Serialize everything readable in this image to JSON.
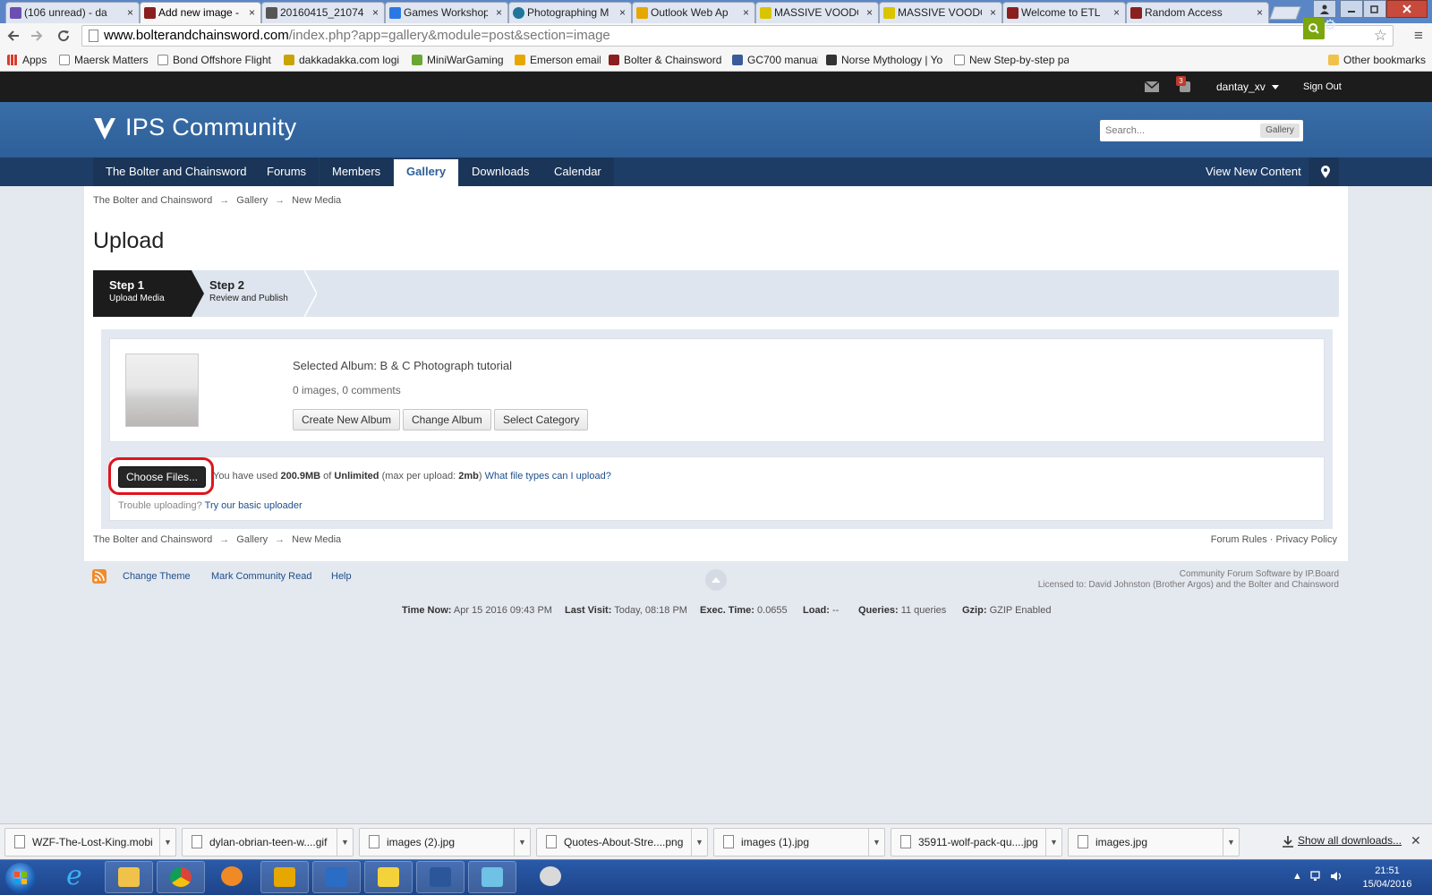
{
  "browser": {
    "tabs": [
      {
        "title": "(106 unread) - da",
        "favicon_color": "#6b4fb0"
      },
      {
        "title": "Add new image -",
        "favicon_color": "#8a1f1f"
      },
      {
        "title": "20160415_21074",
        "favicon_color": "#555555"
      },
      {
        "title": "Games Workshop",
        "favicon_color": "#2b78e4"
      },
      {
        "title": "Photographing M",
        "favicon_color": "#21759b"
      },
      {
        "title": "Outlook Web Ap",
        "favicon_color": "#e6a700"
      },
      {
        "title": "MASSIVE VOODO",
        "favicon_color": "#d9c400"
      },
      {
        "title": "MASSIVE VOODO",
        "favicon_color": "#d9c400"
      },
      {
        "title": "Welcome to ETL",
        "favicon_color": "#8a1f1f"
      },
      {
        "title": "Random Access",
        "favicon_color": "#8a1f1f"
      }
    ],
    "tab_close_glyph": "×",
    "url_host": "www.bolterandchainsword.com",
    "url_path": "/index.php?app=gallery&module=post&section=image",
    "bookmarks": [
      {
        "label": "Apps",
        "icon_color": "#d93b2b"
      },
      {
        "label": "Maersk Matters",
        "icon_color": "#cccccc"
      },
      {
        "label": "Bond Offshore Flight",
        "icon_color": "#cccccc"
      },
      {
        "label": "dakkadakka.com logi",
        "icon_color": "#c9a400"
      },
      {
        "label": "MiniWarGaming",
        "icon_color": "#6aa632"
      },
      {
        "label": "Emerson email",
        "icon_color": "#e6a700"
      },
      {
        "label": "Bolter & Chainsword",
        "icon_color": "#8a1f1f"
      },
      {
        "label": "GC700 manual",
        "icon_color": "#3b5a9a"
      },
      {
        "label": "Norse Mythology | Yo",
        "icon_color": "#333333"
      },
      {
        "label": "New Step-by-step pa",
        "icon_color": "#cccccc"
      }
    ],
    "other_bookmarks": "Other bookmarks"
  },
  "userbar": {
    "notification_count": "3",
    "username": "dantay_xv",
    "sign_out": "Sign Out"
  },
  "header": {
    "site_name": "IPS Community",
    "search_placeholder": "Search...",
    "search_scope": "Gallery"
  },
  "nav": {
    "items": [
      "The Bolter and Chainsword",
      "Forums",
      "Members",
      "Gallery",
      "Downloads",
      "Calendar"
    ],
    "view_new_content": "View New Content"
  },
  "breadcrumb": [
    "The Bolter and Chainsword",
    "Gallery",
    "New Media"
  ],
  "breadcrumb_separator": "→",
  "page_title": "Upload",
  "wizard": {
    "step1_title": "Step 1",
    "step1_desc": "Upload Media",
    "step2_title": "Step 2",
    "step2_desc": "Review and Publish"
  },
  "album": {
    "selected": "Selected Album: B & C Photograph tutorial",
    "stats": "0 images, 0 comments",
    "buttons": [
      "Create New Album",
      "Change Album",
      "Select Category"
    ]
  },
  "upload": {
    "choose_files": "Choose Files...",
    "usage_prefix": "You have used",
    "used": "200.9MB",
    "usage_of": "of",
    "limit": "Unlimited",
    "max_prefix": "(max per upload:",
    "max_value": "2mb",
    "max_suffix": ")",
    "file_types_link": "What file types can I upload?",
    "trouble_text": "Trouble uploading?",
    "basic_uploader_link": "Try our basic uploader"
  },
  "footer": {
    "forum_rules": "Forum Rules",
    "dot": "·",
    "privacy_policy": "Privacy Policy",
    "links": [
      "Change Theme",
      "Mark Community Read",
      "Help"
    ],
    "copyright_line1": "Community Forum Software by IP.Board",
    "copyright_line2": "Licensed to: David Johnston (Brother Argos) and the Bolter and Chainsword",
    "stats": [
      {
        "label": "Time Now:",
        "value": "Apr 15 2016 09:43 PM"
      },
      {
        "label": "Last Visit:",
        "value": "Today, 08:18 PM"
      },
      {
        "label": "Exec. Time:",
        "value": "0.0655"
      },
      {
        "label": "Load:",
        "value": "--"
      },
      {
        "label": "Queries:",
        "value": "11 queries"
      },
      {
        "label": "Gzip:",
        "value": "GZIP Enabled"
      }
    ]
  },
  "downloads": {
    "files": [
      "WZF-The-Lost-King.mobi",
      "dylan-obrian-teen-w....gif",
      "images (2).jpg",
      "Quotes-About-Stre....png",
      "images (1).jpg",
      "35911-wolf-pack-qu....jpg",
      "images.jpg"
    ],
    "show_all": "Show all downloads..."
  },
  "taskbar": {
    "time": "21:51",
    "date": "15/04/2016"
  },
  "colors": {
    "header_blue": "#2d5f98",
    "nav_dark": "#1e3d66",
    "highlight_red": "#e0141c",
    "search_green": "#7ba60d"
  }
}
